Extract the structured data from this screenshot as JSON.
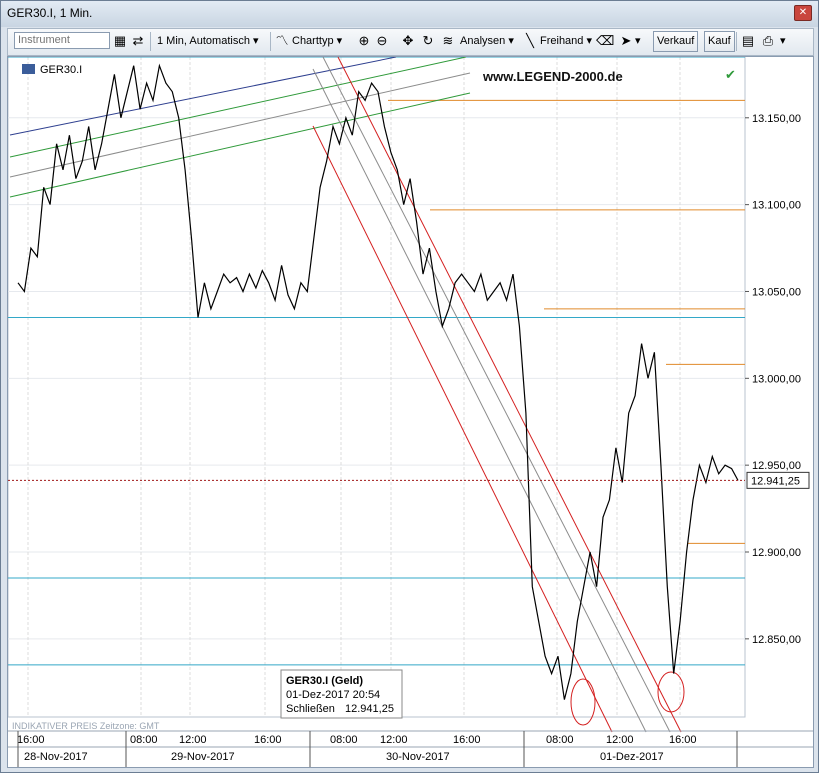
{
  "window": {
    "title": "GER30.I, 1 Min."
  },
  "toolbar": {
    "instrument_placeholder": "Instrument",
    "timeframe": "1 Min, Automatisch",
    "charttype": "Charttyp",
    "analysen": "Analysen",
    "freihand": "Freihand",
    "sell": "Verkauf",
    "buy": "Kauf"
  },
  "chart": {
    "symbol": "GER30.I",
    "watermark": "www.LEGEND-2000.de",
    "footer_note": "INDIKATIVER PREIS  Zeitzone: GMT",
    "price_tag": "12.941,25",
    "colors": {
      "price": "#000000",
      "cyan": "#33a8c8",
      "orange": "#e08a2a",
      "red": "#d42020",
      "gray": "#8c8c8c",
      "green": "#2f9a3a",
      "navy": "#2e3f8f",
      "close_line": "#a01818"
    },
    "tooltip": {
      "title": "GER30.I (Geld)",
      "date": "01-Dez-2017 20:54",
      "close_label": "Schließen",
      "close_value": "12.941,25"
    }
  },
  "chart_data": {
    "type": "line",
    "title": "GER30.I, 1 Min.",
    "xlabel": "",
    "ylabel": "",
    "ylim": [
      12805,
      13185
    ],
    "y_ticks": [
      {
        "value": 13150,
        "label": "13.150,00"
      },
      {
        "value": 13100,
        "label": "13.100,00"
      },
      {
        "value": 13050,
        "label": "13.050,00"
      },
      {
        "value": 13000,
        "label": "13.000,00"
      },
      {
        "value": 12950,
        "label": "12.950,00"
      },
      {
        "value": 12900,
        "label": "12.900,00"
      },
      {
        "value": 12850,
        "label": "12.850,00"
      }
    ],
    "x_ticks": [
      "16:00",
      "08:00",
      "12:00",
      "16:00",
      "08:00",
      "12:00",
      "16:00",
      "08:00",
      "12:00",
      "16:00"
    ],
    "day_labels": [
      "28-Nov-2017",
      "29-Nov-2017",
      "30-Nov-2017",
      "01-Dez-2017"
    ],
    "last_close": 12941.25,
    "grid": true,
    "series": [
      {
        "values": [
          13055,
          13050,
          13075,
          13070,
          13110,
          13100,
          13135,
          13120,
          13140,
          13115,
          13125,
          13145,
          13120,
          13135,
          13155,
          13175,
          13150,
          13165,
          13180,
          13155,
          13170,
          13160,
          13180,
          13170,
          13165,
          13150,
          13120,
          13080,
          13035,
          13055,
          13040,
          13050,
          13060,
          13055,
          13058,
          13050,
          13060,
          13052,
          13062,
          13055,
          13045,
          13065,
          13048,
          13040,
          13055,
          13050,
          13080,
          13110,
          13125,
          13145,
          13135,
          13150,
          13140,
          13165,
          13160,
          13170,
          13165,
          13145,
          13130,
          13120,
          13100,
          13115,
          13090,
          13060,
          13075,
          13050,
          13030,
          13040,
          13055,
          13060,
          13055,
          13050,
          13060,
          13045,
          13050,
          13055,
          13045,
          13060,
          13030,
          12980,
          12880,
          12860,
          12840,
          12830,
          12840,
          12815,
          12830,
          12860,
          12880,
          12900,
          12880,
          12920,
          12930,
          12960,
          12940,
          12980,
          12990,
          13020,
          13000,
          13015,
          12950,
          12880,
          12830,
          12860,
          12900,
          12930,
          12950,
          12940,
          12955,
          12945,
          12950,
          12948,
          12941.25
        ]
      }
    ]
  }
}
